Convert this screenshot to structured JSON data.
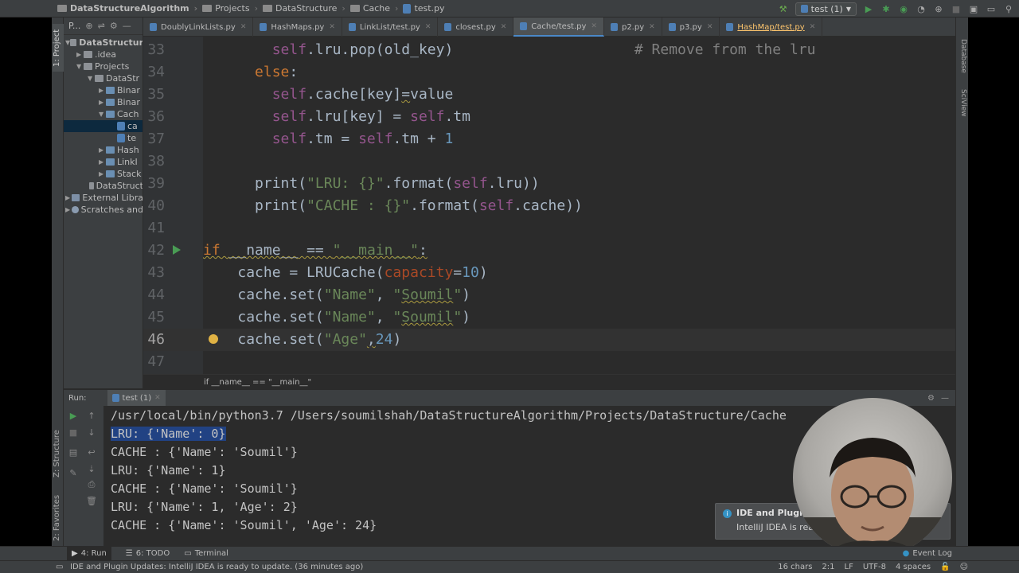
{
  "navbar": {
    "crumbs": [
      "DataStructureAlgorithm",
      "Projects",
      "DataStructure",
      "Cache",
      "test.py"
    ],
    "run_config": "test (1)"
  },
  "project_panel": {
    "header": "P...",
    "stripe_label": "1: Project",
    "tree": [
      {
        "label": "DataStructur",
        "arrow": "▼",
        "icon": "folder"
      },
      {
        "label": ".idea",
        "arrow": "▶",
        "icon": "folder"
      },
      {
        "label": "Projects",
        "arrow": "▼",
        "icon": "folder"
      },
      {
        "label": "DataStr",
        "arrow": "▼",
        "icon": "folder"
      },
      {
        "label": "Binar",
        "arrow": "▶",
        "icon": "folder"
      },
      {
        "label": "Binar",
        "arrow": "▶",
        "icon": "folder"
      },
      {
        "label": "Cach",
        "arrow": "▼",
        "icon": "folder"
      },
      {
        "label": "ca",
        "arrow": "",
        "icon": "python-file"
      },
      {
        "label": "te",
        "arrow": "",
        "icon": "python-file"
      },
      {
        "label": "Hash",
        "arrow": "▶",
        "icon": "folder"
      },
      {
        "label": "LinkI",
        "arrow": "▶",
        "icon": "folder"
      },
      {
        "label": "Stack",
        "arrow": "▶",
        "icon": "folder"
      },
      {
        "label": "DataStruct",
        "arrow": "",
        "icon": "folder"
      },
      {
        "label": "External Libra",
        "arrow": "▶",
        "icon": "library"
      },
      {
        "label": "Scratches and",
        "arrow": "▶",
        "icon": "scratches"
      }
    ]
  },
  "tabs": [
    {
      "label": "DoublyLinkLists.py",
      "active": false,
      "modified": false
    },
    {
      "label": "HashMaps.py",
      "active": false,
      "modified": false
    },
    {
      "label": "LinkList/test.py",
      "active": false,
      "modified": false
    },
    {
      "label": "closest.py",
      "active": false,
      "modified": false
    },
    {
      "label": "Cache/test.py",
      "active": true,
      "modified": false
    },
    {
      "label": "p2.py",
      "active": false,
      "modified": false
    },
    {
      "label": "p3.py",
      "active": false,
      "modified": false
    },
    {
      "label": "HashMap/test.py",
      "active": false,
      "modified": true
    }
  ],
  "editor": {
    "lines": [
      {
        "num": "33",
        "current": false
      },
      {
        "num": "34",
        "current": false
      },
      {
        "num": "35",
        "current": false
      },
      {
        "num": "36",
        "current": false
      },
      {
        "num": "37",
        "current": false
      },
      {
        "num": "38",
        "current": false
      },
      {
        "num": "39",
        "current": false
      },
      {
        "num": "40",
        "current": false
      },
      {
        "num": "41",
        "current": false
      },
      {
        "num": "42",
        "current": false
      },
      {
        "num": "43",
        "current": false
      },
      {
        "num": "44",
        "current": false
      },
      {
        "num": "45",
        "current": false
      },
      {
        "num": "46",
        "current": true
      },
      {
        "num": "47",
        "current": false
      }
    ],
    "code": {
      "l33_self": "self",
      "l33_rest": ".lru.pop(old_key)",
      "l33_comment": "# Remove from the lru",
      "l34_else": "else",
      "l34_colon": ":",
      "l35_self": "self",
      "l35_a": ".cache[key]",
      "l35_eq": "=",
      "l35_b": "value",
      "l36_self": "self",
      "l36_a": ".lru[key] = ",
      "l36_self2": "self",
      "l36_b": ".tm",
      "l37_self": "self",
      "l37_a": ".tm = ",
      "l37_self2": "self",
      "l37_b": ".tm + ",
      "l37_num": "1",
      "l39_print": "print(",
      "l39_str": "\"LRU: {}\"",
      "l39_a": ".format(",
      "l39_self": "self",
      "l39_b": ".lru))",
      "l40_print": "print(",
      "l40_str": "\"CACHE : {}\"",
      "l40_a": ".format(",
      "l40_self": "self",
      "l40_b": ".cache))",
      "l42_if": "if",
      "l42_sp": " ",
      "l42_name": "__name__",
      "l42_eq": " == ",
      "l42_str": "\"__main__\"",
      "l42_colon": ":",
      "l43_a": "cache = LRUCache(",
      "l43_param": "capacity",
      "l43_eq": "=",
      "l43_num": "10",
      "l43_b": ")",
      "l44_a": "cache.set(",
      "l44_s1": "\"Name\"",
      "l44_c": ", ",
      "l44_s2a": "\"",
      "l44_s2": "Soumil",
      "l44_s2b": "\"",
      "l44_b": ")",
      "l45_a": "cache.set(",
      "l45_s1": "\"Name\"",
      "l45_c": ", ",
      "l45_s2a": "\"",
      "l45_s2": "Soumil",
      "l45_s2b": "\"",
      "l45_b": ")",
      "l46_a": "cache.set(",
      "l46_s1": "\"Age\"",
      "l46_c": ",",
      "l46_num": "24",
      "l46_b": ")"
    },
    "breadcrumb": "if __name__ == \"__main__\""
  },
  "right_stripe": {
    "database": "Database",
    "sciview": "SciView"
  },
  "run_panel": {
    "label": "Run:",
    "tab": "test (1)",
    "console": [
      "/usr/local/bin/python3.7 /Users/soumilshah/DataStructureAlgorithm/Projects/DataStructure/Cache",
      "LRU: {'Name': 0}",
      "CACHE : {'Name': 'Soumil'}",
      "LRU: {'Name': 1}",
      "CACHE : {'Name': 'Soumil'}",
      "LRU: {'Name': 1, 'Age': 2}",
      "CACHE : {'Name': 'Soumil', 'Age': 24}"
    ]
  },
  "notification": {
    "title": "IDE and Plugin",
    "body": "IntelliJ IDEA is rea"
  },
  "tool_tabs": [
    {
      "label": "4: Run",
      "active": true
    },
    {
      "label": "6: TODO",
      "active": false
    },
    {
      "label": "Terminal",
      "active": false
    }
  ],
  "left_stripe": {
    "structure": "Z: Structure",
    "favorites": "2: Favorites"
  },
  "event_log": "Event Log",
  "status": {
    "message": "IDE and Plugin Updates: IntelliJ IDEA is ready to update. (36 minutes ago)",
    "chars": "16 chars",
    "pos": "2:1",
    "lf": "LF",
    "enc": "UTF-8",
    "indent": "4 spaces"
  }
}
